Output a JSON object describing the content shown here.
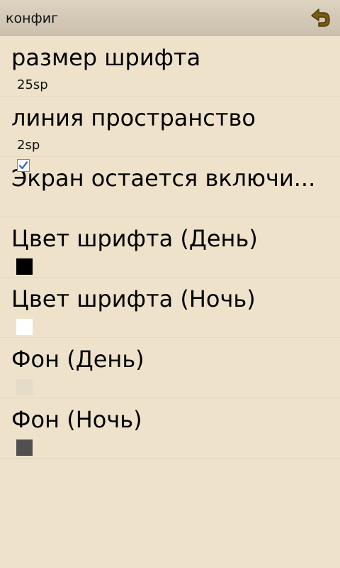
{
  "titlebar": {
    "title": "конфиг",
    "back_icon": "back-arrow-icon"
  },
  "settings": {
    "font_size": {
      "title": "размер шрифта",
      "value": "25sp"
    },
    "line_spacing": {
      "title": "линия пространство",
      "value": "2sp"
    },
    "screen_on": {
      "title": "Экран остается включи...",
      "checked": true
    },
    "font_color_day": {
      "title": "Цвет шрифта (День)",
      "color": "#000000"
    },
    "font_color_night": {
      "title": "Цвет шрифта (Ночь)",
      "color": "#ffffff"
    },
    "background_day": {
      "title": "Фон (День)",
      "color": "#e4dcc6"
    },
    "background_night": {
      "title": "Фон (Ночь)",
      "color": "#505050"
    }
  },
  "colors": {
    "page_background": "#efe2cb",
    "titlebar": "#d6ccb9",
    "back_icon": "#7b5b12",
    "checkbox_check": "#2b63b8"
  }
}
